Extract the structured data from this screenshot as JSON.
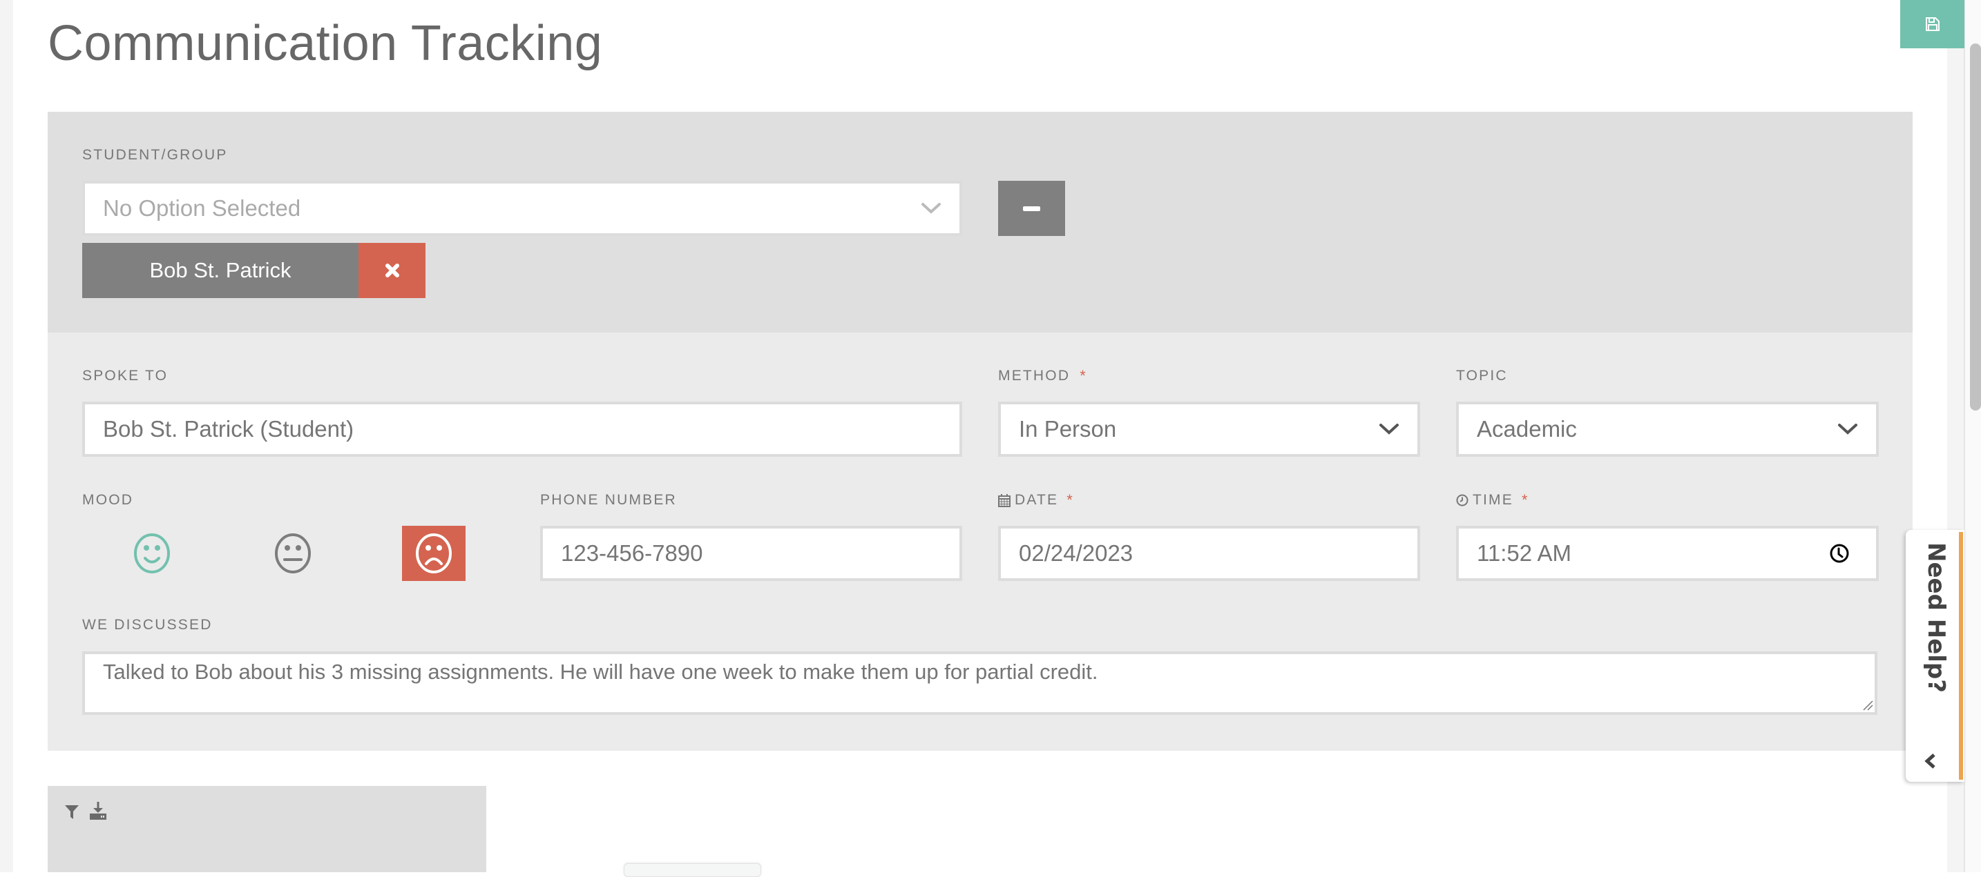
{
  "page": {
    "title": "Communication Tracking"
  },
  "toolbar": {
    "save_icon": "floppy-disk-icon"
  },
  "student_group": {
    "label": "STUDENT/GROUP",
    "select_placeholder": "No Option Selected",
    "remove_button_icon": "minus-icon",
    "selected_tags": [
      {
        "label": "Bob St. Patrick",
        "remove_icon": "times-icon"
      }
    ]
  },
  "form": {
    "spoke_to": {
      "label": "SPOKE TO",
      "value": "Bob St. Patrick (Student)"
    },
    "method": {
      "label": "METHOD",
      "required": "*",
      "value": "In Person"
    },
    "topic": {
      "label": "TOPIC",
      "value": "Academic"
    },
    "mood": {
      "label": "MOOD",
      "options": [
        {
          "name": "happy",
          "icon": "smile-icon",
          "selected": false
        },
        {
          "name": "neutral",
          "icon": "meh-icon",
          "selected": false
        },
        {
          "name": "sad",
          "icon": "frown-icon",
          "selected": true
        }
      ]
    },
    "phone_number": {
      "label": "PHONE NUMBER",
      "value": "123-456-7890"
    },
    "date": {
      "label": "DATE",
      "required": "*",
      "icon": "calendar-icon",
      "value": "02/24/2023"
    },
    "time": {
      "label": "TIME",
      "required": "*",
      "icon": "clock-icon",
      "value": "11:52 AM"
    },
    "we_discussed": {
      "label": "WE DISCUSSED",
      "value": "Talked to Bob about his 3 missing assignments. He will have one week to make them up for partial credit."
    }
  },
  "table_toolbar": {
    "filter_icon": "filter-icon",
    "download_icon": "download-icon"
  },
  "help_widget": {
    "label": "Need Help?",
    "toggle_icon": "chevron-left-icon"
  },
  "colors": {
    "accent_teal": "#72c1ae",
    "danger_red": "#d46450",
    "help_orange": "#eca44f",
    "tag_gray": "#808080"
  }
}
